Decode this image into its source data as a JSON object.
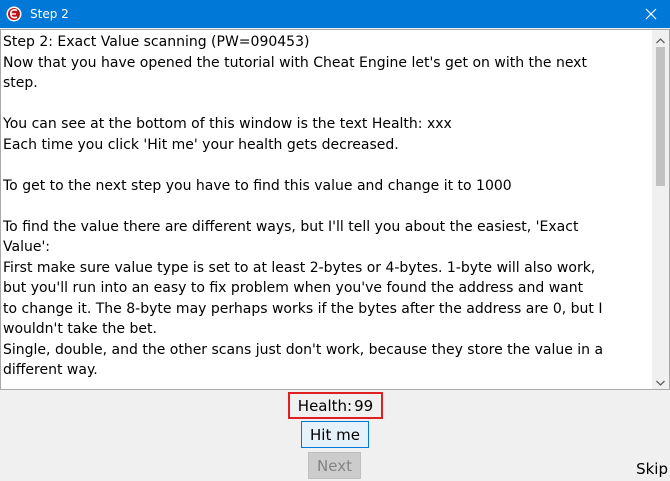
{
  "window": {
    "title": "Step 2",
    "icon": "cheat-engine-logo-icon",
    "close_icon": "close-icon"
  },
  "tutorial": {
    "lines": [
      "Step 2: Exact Value scanning (PW=090453)",
      "Now that you have opened the tutorial with Cheat Engine let's get on with the next",
      "step.",
      "",
      "You can see at the bottom of this window is the text Health: xxx",
      "Each time you click 'Hit me'  your health gets decreased.",
      "",
      "To get to the next step you have to find this value and change it to 1000",
      "",
      "To find the value there are different ways, but I'll tell you about the easiest, 'Exact",
      "Value':",
      "First make sure value type is set to at least 2-bytes or 4-bytes. 1-byte will also work,",
      "but you'll run into an easy to fix problem when you've found the address and want",
      "to change it. The 8-byte may perhaps works if the bytes after the address are 0, but I",
      "wouldn't take the bet.",
      "Single, double, and the other scans just don't work, because they store the value in a",
      "different way."
    ]
  },
  "status": {
    "health_label": "Health:",
    "health_value": "99"
  },
  "buttons": {
    "hit_me": "Hit me",
    "next": "Next",
    "skip": "Skip"
  },
  "colors": {
    "titlebar": "#0078d7",
    "highlight_border": "#e02020",
    "button_focus": "#0078d7"
  }
}
